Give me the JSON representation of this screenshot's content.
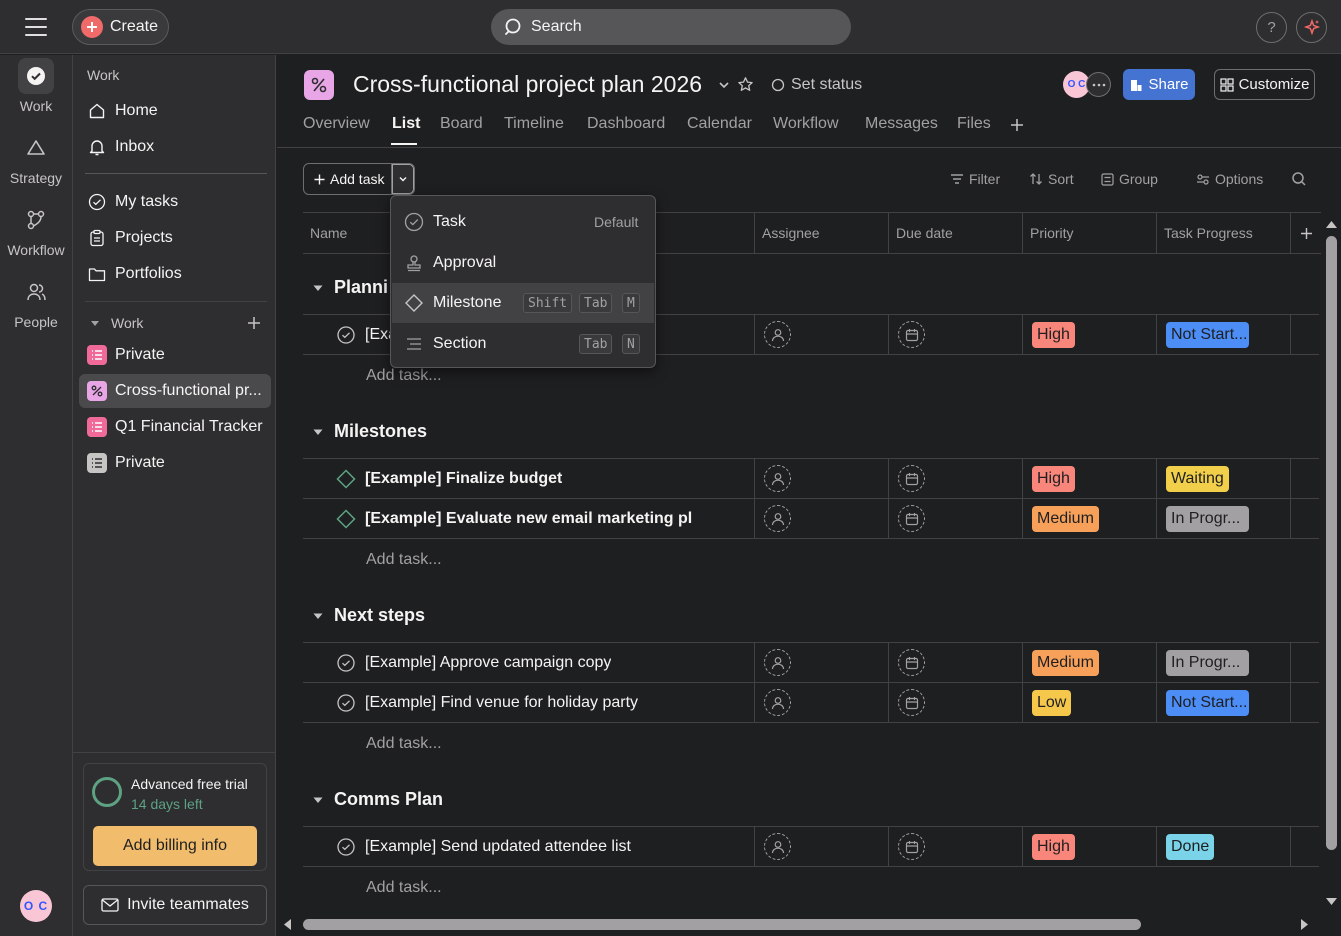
{
  "topbar": {
    "create_label": "Create",
    "search_label": "Search",
    "help_label": "?"
  },
  "rail": {
    "items": [
      {
        "label": "Work",
        "icon": "check-circle-icon"
      },
      {
        "label": "Strategy",
        "icon": "triangle-icon"
      },
      {
        "label": "Workflow",
        "icon": "workflow-icon"
      },
      {
        "label": "People",
        "icon": "people-icon"
      }
    ],
    "avatar_initials": "O C"
  },
  "sidebar": {
    "header": "Work",
    "nav": [
      {
        "label": "Home",
        "icon": "home-icon"
      },
      {
        "label": "Inbox",
        "icon": "bell-icon"
      }
    ],
    "main": [
      {
        "label": "My tasks",
        "icon": "check-circle-icon"
      },
      {
        "label": "Projects",
        "icon": "clipboard-icon"
      },
      {
        "label": "Portfolios",
        "icon": "folder-icon"
      }
    ],
    "section_label": "Work",
    "projects": [
      {
        "label": "Private",
        "color": "#f06a99",
        "icon": "list-icon"
      },
      {
        "label": "Cross-functional pr...",
        "color": "#e9a6e7",
        "icon": "percent-icon"
      },
      {
        "label": "Q1 Financial Tracker",
        "color": "#f06a99",
        "icon": "list-icon"
      },
      {
        "label": "Private",
        "color": "#c7c4c4",
        "icon": "list-icon"
      }
    ],
    "trial": {
      "title": "Advanced free trial",
      "days_left": "14 days left",
      "billing_label": "Add billing info"
    },
    "invite_label": "Invite teammates"
  },
  "project": {
    "title": "Cross-functional project plan 2026",
    "set_status": "Set status",
    "share_label": "Share",
    "customize_label": "Customize",
    "avatar_initials": "O C",
    "tabs": [
      "Overview",
      "List",
      "Board",
      "Timeline",
      "Dashboard",
      "Calendar",
      "Workflow",
      "Messages",
      "Files"
    ],
    "active_tab": "List"
  },
  "toolbar": {
    "add_task_label": "Add task",
    "filter": "Filter",
    "sort": "Sort",
    "group": "Group",
    "options": "Options"
  },
  "columns": [
    "Name",
    "Assignee",
    "Due date",
    "Priority",
    "Task Progress"
  ],
  "dropdown": {
    "items": [
      {
        "label": "Task",
        "hint": "Default",
        "icon": "check-circle-icon"
      },
      {
        "label": "Approval",
        "icon": "stamp-icon"
      },
      {
        "label": "Milestone",
        "keys": [
          "Shift",
          "Tab",
          "M"
        ],
        "icon": "diamond-icon"
      },
      {
        "label": "Section",
        "keys": [
          "Tab",
          "N"
        ],
        "icon": "section-icon"
      }
    ]
  },
  "sections": [
    {
      "title": "Planni",
      "add_task": "Add task...",
      "tasks": [
        {
          "name": "[Exa",
          "type": "task",
          "priority": "High",
          "progress": "Not Start..."
        }
      ]
    },
    {
      "title": "Milestones",
      "add_task": "Add task...",
      "tasks": [
        {
          "name": "[Example] Finalize budget",
          "type": "milestone",
          "priority": "High",
          "progress": "Waiting"
        },
        {
          "name": "[Example] Evaluate new email marketing pl",
          "type": "milestone",
          "priority": "Medium",
          "progress": "In Progr..."
        }
      ]
    },
    {
      "title": "Next steps",
      "add_task": "Add task...",
      "tasks": [
        {
          "name": "[Example] Approve campaign copy",
          "type": "task",
          "priority": "Medium",
          "progress": "In Progr..."
        },
        {
          "name": "[Example] Find venue for holiday party",
          "type": "task",
          "priority": "Low",
          "progress": "Not Start..."
        }
      ]
    },
    {
      "title": "Comms Plan",
      "add_task": "Add task...",
      "tasks": [
        {
          "name": "[Example] Send updated attendee list",
          "type": "task",
          "priority": "High",
          "progress": "Done"
        }
      ]
    }
  ],
  "colors": {
    "High": "#f8867a",
    "Medium": "#f7a05a",
    "Low": "#f5c84c",
    "Not Start...": "#4c8df6",
    "Waiting": "#f2cf4a",
    "In Progr...": "#a2a0a2",
    "Done": "#7ad3e8"
  }
}
